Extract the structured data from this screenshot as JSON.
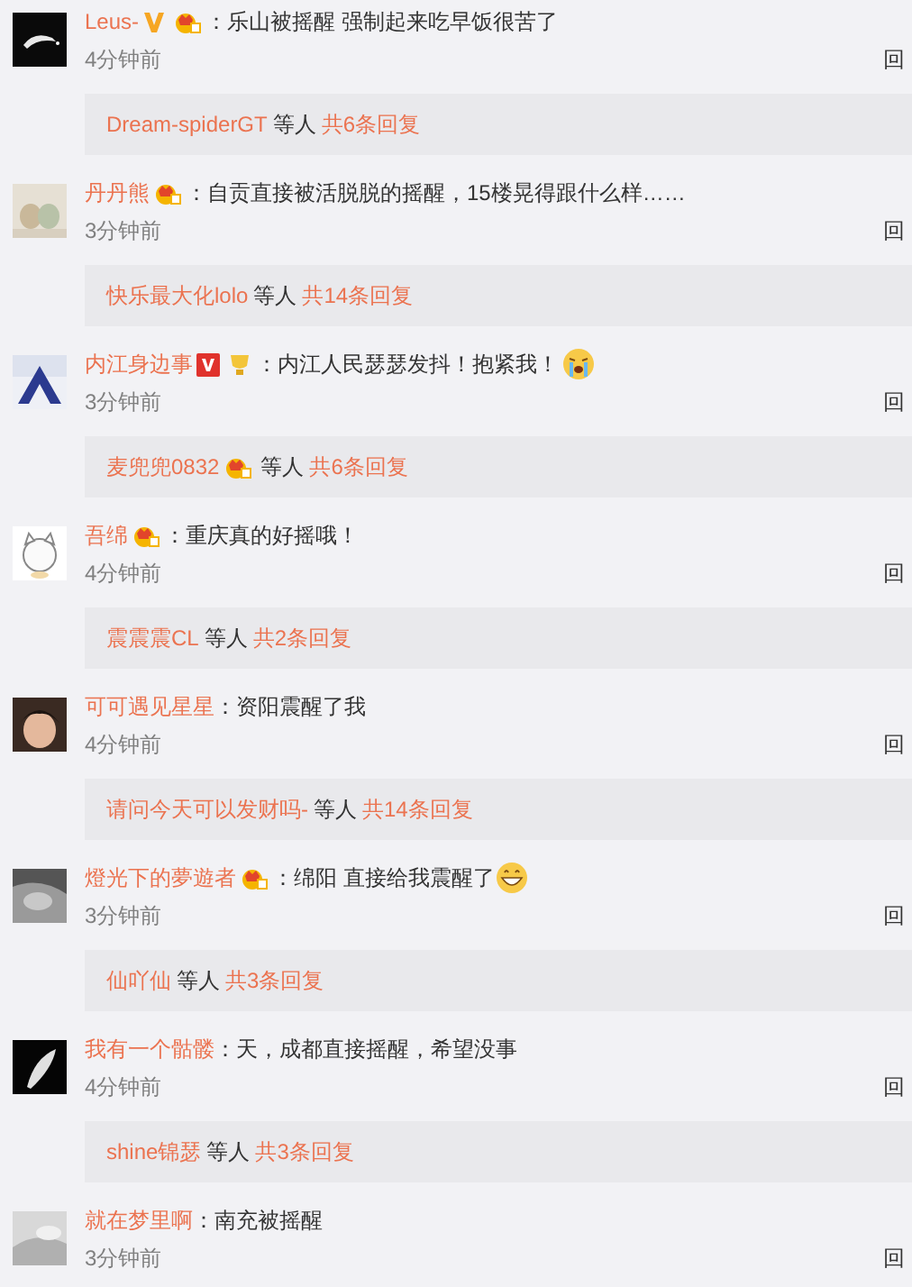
{
  "comments": [
    {
      "name": "Leus-",
      "badges": [
        {
          "kind": "v_orange"
        },
        {
          "kind": "member"
        }
      ],
      "text": "：乐山被摇醒 强制起来吃早饭很苦了",
      "time": "4分钟前",
      "reply": "回",
      "thread": {
        "names": "Dream-spiderGT",
        "others": "等人",
        "count": "共6条回复"
      }
    },
    {
      "name": "丹丹熊",
      "badges": [
        {
          "kind": "member"
        }
      ],
      "text": "：自贡直接被活脱脱的摇醒，15楼晃得跟什么样……",
      "time": "3分钟前",
      "reply": "回",
      "thread": {
        "names": "快乐最大化lolo",
        "others": "等人",
        "count": "共14条回复"
      }
    },
    {
      "name": "内江身边事",
      "badges": [
        {
          "kind": "v_red"
        },
        {
          "kind": "gold"
        }
      ],
      "text": "：内江人民瑟瑟发抖！抱紧我！",
      "emoji": {
        "kind": "crying"
      },
      "time": "3分钟前",
      "reply": "回",
      "thread": {
        "names": "麦兜兜0832",
        "name_badges": [
          {
            "kind": "member"
          }
        ],
        "others": "等人",
        "count": "共6条回复"
      }
    },
    {
      "name": "吾绵",
      "badges": [
        {
          "kind": "member"
        }
      ],
      "text": "：重庆真的好摇哦！",
      "time": "4分钟前",
      "reply": "回",
      "thread": {
        "names": "震震震CL",
        "others": "等人",
        "count": "共2条回复"
      }
    },
    {
      "name": "可可遇见星星",
      "text": "：资阳震醒了我",
      "time": "4分钟前",
      "reply": "回",
      "thread": {
        "names": "请问今天可以发财吗-",
        "others": "等人",
        "count": "共14条回复"
      }
    },
    {
      "name": "燈光下的夢遊者",
      "badges": [
        {
          "kind": "member"
        }
      ],
      "text": "：绵阳 直接给我震醒了",
      "emoji": {
        "kind": "grin"
      },
      "time": "3分钟前",
      "reply": "回",
      "thread": {
        "names": "仙吖仙",
        "others": "等人",
        "count": "共3条回复"
      }
    },
    {
      "name": "我有一个骷髅",
      "text": "：天，成都直接摇醒，希望没事",
      "time": "4分钟前",
      "reply": "回",
      "thread": {
        "names": "shine锦瑟",
        "others": "等人",
        "count": "共3条回复"
      }
    },
    {
      "name": "就在梦里啊",
      "text": "：南充被摇醒",
      "time": "3分钟前",
      "reply": "回"
    }
  ]
}
